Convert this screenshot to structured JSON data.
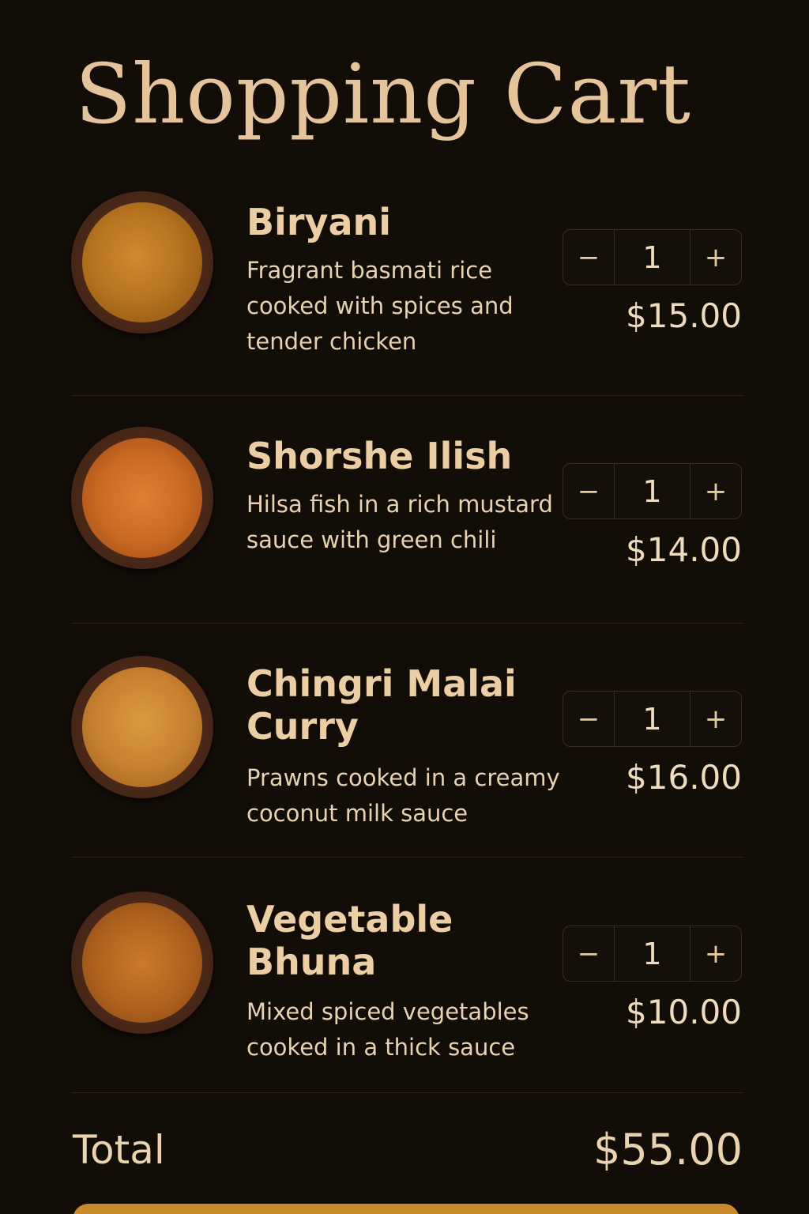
{
  "header": {
    "title": "Shopping Cart"
  },
  "items": [
    {
      "name": "Biryani",
      "description": "Fragrant basmati rice cooked with spices and tender chicken",
      "quantity": "1",
      "price": "$15.00",
      "image": "biryani-bowl"
    },
    {
      "name": "Shorshe Ilish",
      "description": "Hilsa fish in a rich mustard sauce with green chili",
      "quantity": "1",
      "price": "$14.00",
      "image": "fish-curry-bowl"
    },
    {
      "name": "Chingri Malai Curry",
      "description": "Prawns cooked in a creamy coconut milk sauce",
      "quantity": "1",
      "price": "$16.00",
      "image": "prawn-curry-bowl"
    },
    {
      "name": "Vegetable Bhuna",
      "description": "Mixed spiced vegetables cooked in a thick sauce",
      "quantity": "1",
      "price": "$10.00",
      "image": "vegetable-bowl"
    }
  ],
  "stepper": {
    "decrement": "−",
    "increment": "+"
  },
  "summary": {
    "total_label": "Total",
    "total_value": "$55.00"
  },
  "colors": {
    "background": "#130d08",
    "accent": "#c98a2b",
    "text": "#e9cfa7"
  }
}
